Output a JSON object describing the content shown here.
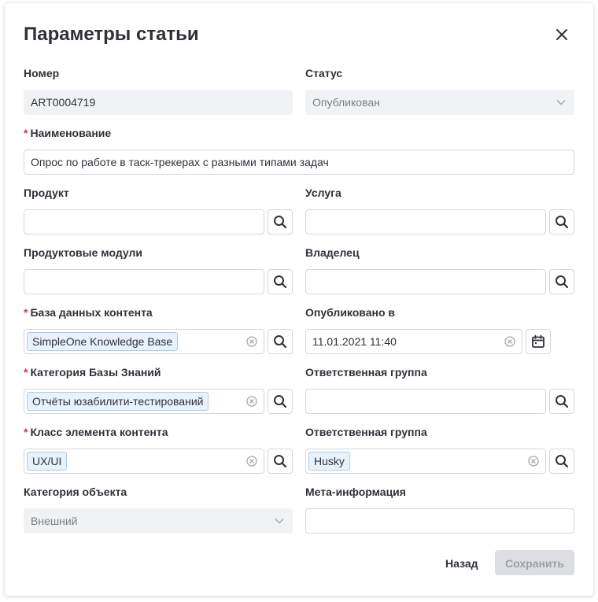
{
  "dialog": {
    "title": "Параметры статьи",
    "close_icon": "close-icon"
  },
  "fields": {
    "number": {
      "label": "Номер",
      "value": "ART0004719"
    },
    "status": {
      "label": "Статус",
      "value": "Опубликован"
    },
    "name": {
      "label": "Наименование",
      "required": true,
      "value": "Опрос по работе в таск-трекерах с разными типами задач"
    },
    "product": {
      "label": "Продукт",
      "value": ""
    },
    "service": {
      "label": "Услуга",
      "value": ""
    },
    "product_modules": {
      "label": "Продуктовые модули",
      "value": ""
    },
    "owner": {
      "label": "Владелец",
      "value": ""
    },
    "content_db": {
      "label": "База данных контента",
      "required": true,
      "chip": "SimpleOne Knowledge Base"
    },
    "published_at": {
      "label": "Опубликовано в",
      "value": "11.01.2021 11:40"
    },
    "kb_category": {
      "label": "Категория Базы Знаний",
      "required": true,
      "chip": "Отчёты юзабилити-тестирований"
    },
    "responsible_group_1": {
      "label": "Ответственная группа",
      "value": ""
    },
    "content_class": {
      "label": "Класс элемента контента",
      "required": true,
      "chip": "UX/UI"
    },
    "responsible_group_2": {
      "label": "Ответственная группа",
      "chip": "Husky"
    },
    "object_category": {
      "label": "Категория объекта",
      "value": "Внешний"
    },
    "meta_info": {
      "label": "Мета-информация",
      "value": ""
    }
  },
  "footer": {
    "back_label": "Назад",
    "save_label": "Сохранить"
  },
  "colors": {
    "required_star": "#d1394a",
    "chip_bg": "#e8f2fb",
    "chip_border": "#a9cdef",
    "readonly_bg": "#f1f2f4",
    "save_disabled_bg": "#dcdee1"
  }
}
